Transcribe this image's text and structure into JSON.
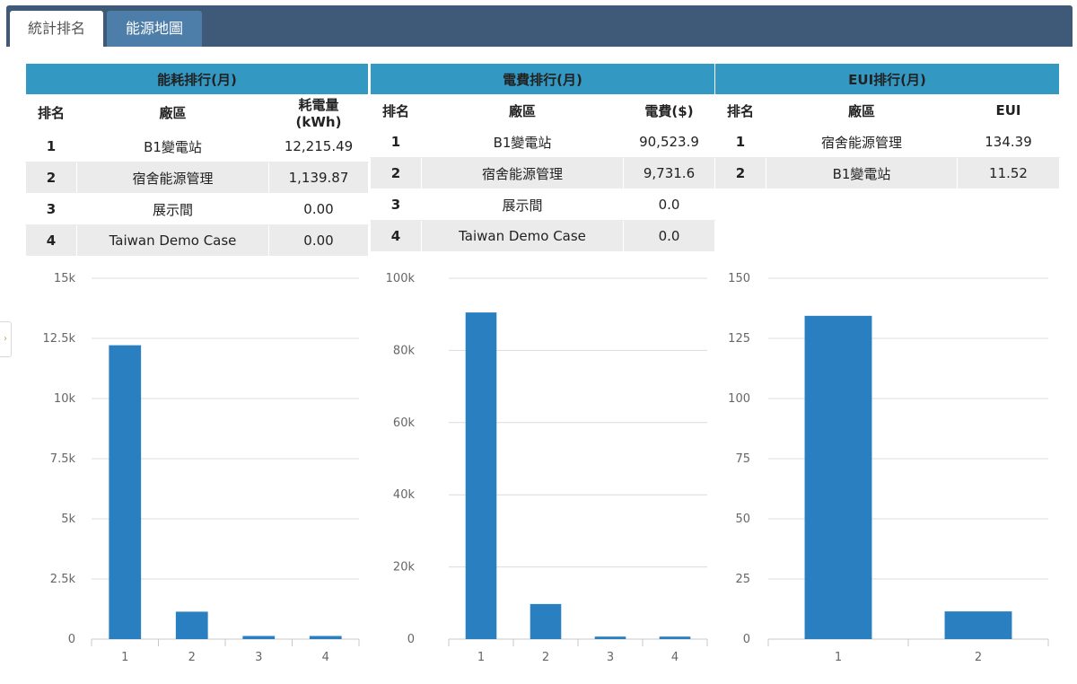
{
  "tabs": [
    {
      "label": "統計排名"
    },
    {
      "label": "能源地圖"
    }
  ],
  "side_handle": {
    "icon": "chevron-right-icon",
    "glyph": "›"
  },
  "colors": {
    "tab_bar": "#3e5a78",
    "tab_inactive": "#4d7eaa",
    "title_bar": "#3399c2",
    "bar": "#2a7fc1",
    "header_text": "#1d3f7e"
  },
  "energy": {
    "title": "能耗排行(月)",
    "headers": {
      "rank": "排名",
      "site": "廠區",
      "value_line1": "耗電量",
      "value_line2": "(kWh)"
    },
    "rows": [
      {
        "rank": "1",
        "site": "B1變電站",
        "value": "12,215.49"
      },
      {
        "rank": "2",
        "site": "宿舍能源管理",
        "value": "1,139.87"
      },
      {
        "rank": "3",
        "site": "展示間",
        "value": "0.00"
      },
      {
        "rank": "4",
        "site": "Taiwan Demo Case",
        "value": "0.00"
      }
    ]
  },
  "fee": {
    "title": "電費排行(月)",
    "headers": {
      "rank": "排名",
      "site": "廠區",
      "value": "電費($)"
    },
    "rows": [
      {
        "rank": "1",
        "site": "B1變電站",
        "value": "90,523.9"
      },
      {
        "rank": "2",
        "site": "宿舍能源管理",
        "value": "9,731.6"
      },
      {
        "rank": "3",
        "site": "展示間",
        "value": "0.0"
      },
      {
        "rank": "4",
        "site": "Taiwan Demo Case",
        "value": "0.0"
      }
    ]
  },
  "eui": {
    "title": "EUI排行(月)",
    "headers": {
      "rank": "排名",
      "site": "廠區",
      "value": "EUI"
    },
    "rows": [
      {
        "rank": "1",
        "site": "宿舍能源管理",
        "value": "134.39"
      },
      {
        "rank": "2",
        "site": "B1變電站",
        "value": "11.52"
      }
    ]
  },
  "chart_data": [
    {
      "type": "bar",
      "categories": [
        "1",
        "2",
        "3",
        "4"
      ],
      "values": [
        12215.49,
        1139.87,
        130,
        130
      ],
      "ylim": [
        0,
        15000
      ],
      "yticks": [
        "0",
        "2.5k",
        "5k",
        "7.5k",
        "10k",
        "12.5k",
        "15k"
      ],
      "grid": true
    },
    {
      "type": "bar",
      "categories": [
        "1",
        "2",
        "3",
        "4"
      ],
      "values": [
        90523.9,
        9731.6,
        700,
        700
      ],
      "ylim": [
        0,
        100000
      ],
      "yticks": [
        "0",
        "20k",
        "40k",
        "60k",
        "80k",
        "100k"
      ],
      "grid": true
    },
    {
      "type": "bar",
      "categories": [
        "1",
        "2"
      ],
      "values": [
        134.39,
        11.52
      ],
      "ylim": [
        0,
        150
      ],
      "yticks": [
        "0",
        "25",
        "50",
        "75",
        "100",
        "125",
        "150"
      ],
      "grid": true
    }
  ]
}
